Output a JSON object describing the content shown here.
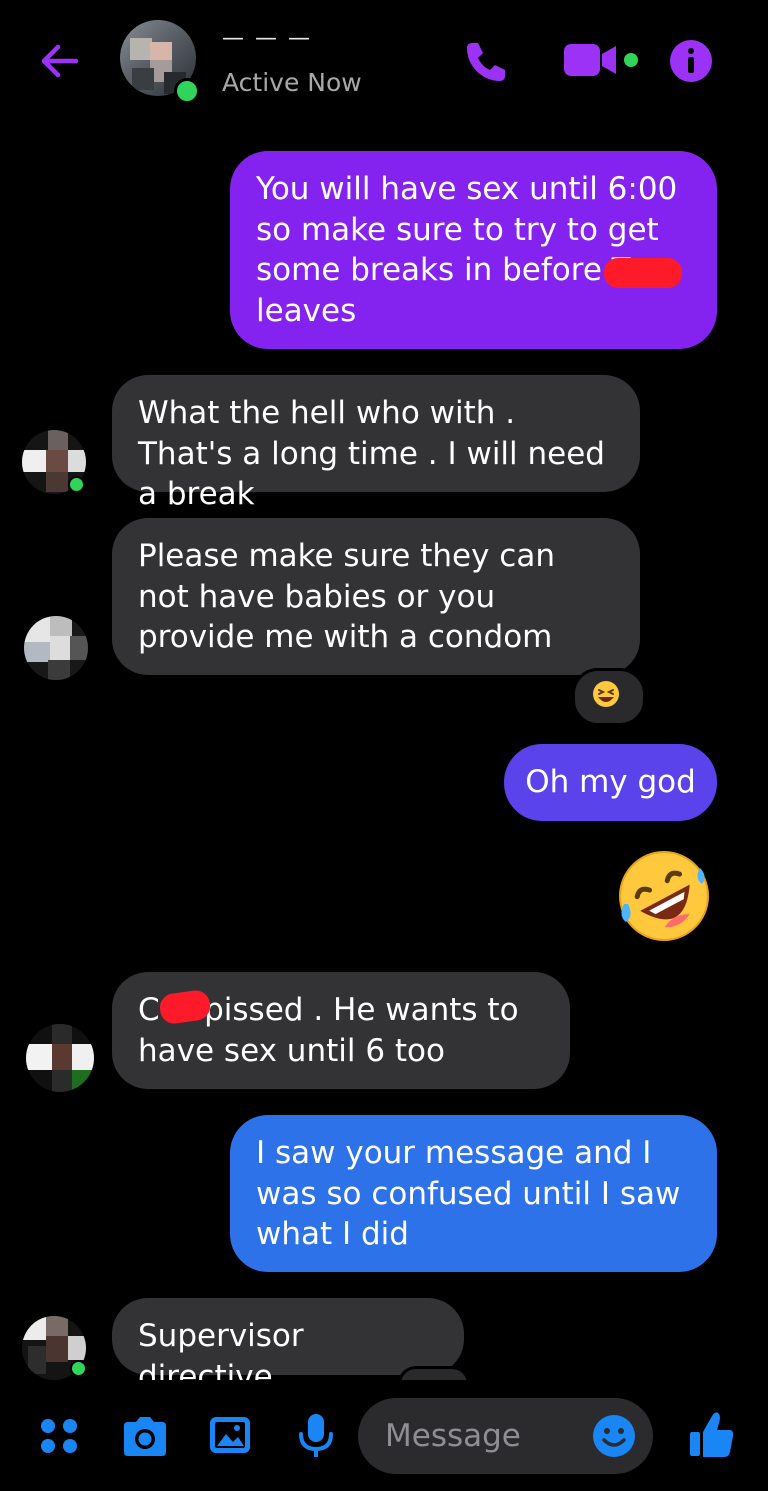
{
  "header": {
    "contact_name": "— — —",
    "status": "Active Now",
    "icons": [
      "back-arrow-icon",
      "phone-icon",
      "video-camera-icon",
      "info-icon"
    ]
  },
  "messages": [
    {
      "from": "me",
      "text": "You will have sex until 6:00 so make sure to try to get some breaks in before T leaves"
    },
    {
      "from": "them",
      "text": "What the hell who with . That's a long time . I will need a break"
    },
    {
      "from": "them",
      "text": "Please make sure they can not have babies or you provide me with a condom",
      "reaction": "😆"
    },
    {
      "from": "me",
      "text": "Oh my god"
    },
    {
      "from": "me",
      "emoji": "🤣"
    },
    {
      "from": "them",
      "text": "C is pissed . He wants to have sex until 6 too"
    },
    {
      "from": "me",
      "text": "I saw your message and I was so confused until I saw what I did"
    },
    {
      "from": "them",
      "text": "Supervisor directive"
    }
  ],
  "composer": {
    "placeholder": "Message",
    "icons": [
      "apps-grid-icon",
      "camera-icon",
      "gallery-icon",
      "microphone-icon",
      "emoji-icon",
      "thumbs-up-icon"
    ]
  },
  "colors": {
    "accent": "#9b32f5",
    "composer_accent": "#1a86f5",
    "bubble_purple": "#8423ef",
    "bubble_indigo": "#5a43ea",
    "bubble_blue": "#2e72ea",
    "bubble_gray": "#333336",
    "online": "#31d45a"
  }
}
